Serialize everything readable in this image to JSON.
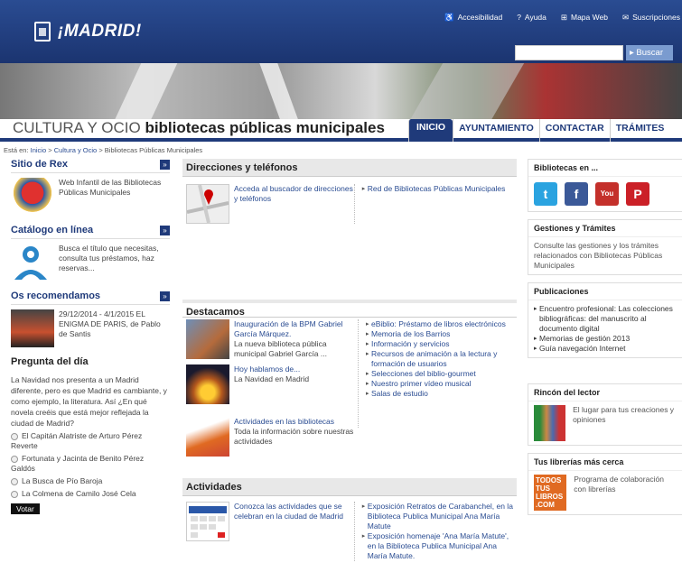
{
  "header": {
    "logo": "¡MADRID!",
    "links": [
      "Accesibilidad",
      "Ayuda",
      "Mapa Web",
      "Suscripciones"
    ],
    "search_button": "Buscar"
  },
  "title": {
    "light": "CULTURA Y OCIO",
    "bold": "bibliotecas públicas municipales"
  },
  "nav": [
    "INICIO",
    "AYUNTAMIENTO",
    "CONTACTAR",
    "TRÁMITES"
  ],
  "breadcrumb": {
    "prefix": "Está en:",
    "items": [
      "Inicio",
      "Cultura y Ocio",
      "Bibliotecas Públicas Municipales"
    ]
  },
  "left": {
    "rex": {
      "title": "Sitio de Rex",
      "text": "Web Infantil de las Bibliotecas Públicas Municipales"
    },
    "catalogo": {
      "title": "Catálogo en línea",
      "text": "Busca el título que necesitas, consulta tus préstamos, haz reservas..."
    },
    "recomendamos": {
      "title": "Os recomendamos",
      "text": "29/12/2014 - 4/1/2015 EL ENIGMA DE PARIS, de Pablo de Santis"
    },
    "poll": {
      "title": "Pregunta del día",
      "question": "La Navidad nos presenta a un Madrid diferente, pero es que Madrid es cambiante, y como ejemplo, la literatura. Así ¿En qué novela creéis que está mejor reflejada la ciudad de Madrid?",
      "options": [
        "El Capitán Alatriste de Arturo Pérez Reverte",
        "Fortunata y Jacinta de Benito Pérez Galdós",
        "La Busca de Pío Baroja",
        "La Colmena de Camilo José Cela"
      ],
      "vote": "Votar"
    }
  },
  "center": {
    "direcciones": {
      "title": "Direcciones y teléfonos",
      "link": "Acceda al buscador de direcciones y teléfonos",
      "right": "Red de Bibliotecas Públicas Municipales"
    },
    "destacamos": {
      "title": "Destacamos",
      "items": [
        {
          "link": "Inauguración de la BPM Gabriel García Márquez.",
          "text": "La nueva biblioteca pública municipal Gabriel García ..."
        },
        {
          "link": "Hoy hablamos de...",
          "text": "La Navidad en Madrid"
        },
        {
          "link": "Actividades en las bibliotecas",
          "text": "Toda la información sobre nuestras actividades"
        }
      ],
      "list": [
        "eBiblio: Préstamo de libros electrónicos",
        "Memoria de los Barrios",
        "Información y servicios",
        "Recursos de animación a la lectura y formación de usuarios",
        "Selecciones del biblio-gourmet",
        "Nuestro primer vídeo musical",
        "Salas de estudio"
      ]
    },
    "actividades": {
      "title": "Actividades",
      "link": "Conozca las actividades que se celebran en la ciudad de Madrid",
      "list": [
        "Exposición Retratos de Carabanchel, en la Biblioteca Publica Municipal Ana María Matute",
        "Exposición homenaje 'Ana María Matute', en la Biblioteca Publica Municipal Ana María Matute."
      ]
    }
  },
  "right": {
    "bibliotecas": {
      "title": "Bibliotecas en ..."
    },
    "gestiones": {
      "title": "Gestiones y Trámites",
      "text": "Consulte las gestiones y los trámites relacionados con Bibliotecas Públicas Municipales"
    },
    "publicaciones": {
      "title": "Publicaciones",
      "list": [
        "Encuentro profesional: Las colecciones bibliográficas: del manuscrito al documento digital",
        "Memorias de gestión 2013",
        "Guía navegación Internet"
      ]
    },
    "rincon": {
      "title": "Rincón del lector",
      "text": "El lugar para tus creaciones y opiniones"
    },
    "librerias": {
      "title": "Tus librerías más cerca",
      "text": "Programa de colaboración con librerías",
      "logo": "TODOS TUS LIBROS .COM"
    }
  }
}
